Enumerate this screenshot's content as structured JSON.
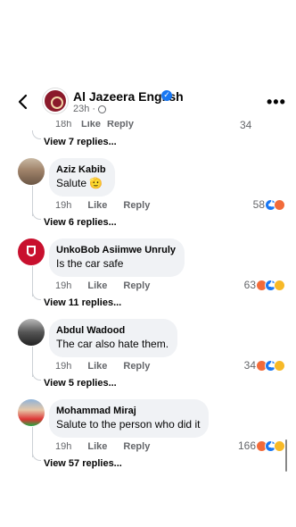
{
  "header": {
    "page_name": "Al Jazeera English",
    "time": "23h",
    "verified_icon": "verified-badge-icon",
    "more_icon": "more-dots-icon"
  },
  "partial_row": {
    "time": "18h",
    "like": "Like",
    "reply": "Reply",
    "count": "34"
  },
  "comments": [
    {
      "view_replies_before": "View 7 replies...",
      "author": "Aziz Kabib",
      "text": "Salute 🫡",
      "time": "19h",
      "like": "Like",
      "reply": "Reply",
      "reaction_count": "58",
      "reactions": [
        "like",
        "angry"
      ],
      "view_replies": "View 6 replies..."
    },
    {
      "author": "UnkoBob Asiimwe Unruly",
      "text": "Is the car safe",
      "time": "19h",
      "like": "Like",
      "reply": "Reply",
      "reaction_count": "63",
      "reactions": [
        "angry",
        "like",
        "haha"
      ],
      "view_replies": "View 11 replies..."
    },
    {
      "author": "Abdul Wadood",
      "text": "The car also hate them.",
      "time": "19h",
      "like": "Like",
      "reply": "Reply",
      "reaction_count": "34",
      "reactions": [
        "angry",
        "like",
        "haha"
      ],
      "view_replies": "View 5 replies..."
    },
    {
      "author": "Mohammad Miraj",
      "text": "Salute to the person who did it",
      "time": "19h",
      "like": "Like",
      "reply": "Reply",
      "reaction_count": "166",
      "reactions": [
        "angry",
        "like",
        "haha"
      ],
      "view_replies": "View 57 replies..."
    }
  ],
  "colors": {
    "like": "#1877f2",
    "angry": "#f26b3a",
    "haha": "#f7b928",
    "bubble": "#f0f2f5",
    "meta": "#65676b"
  }
}
